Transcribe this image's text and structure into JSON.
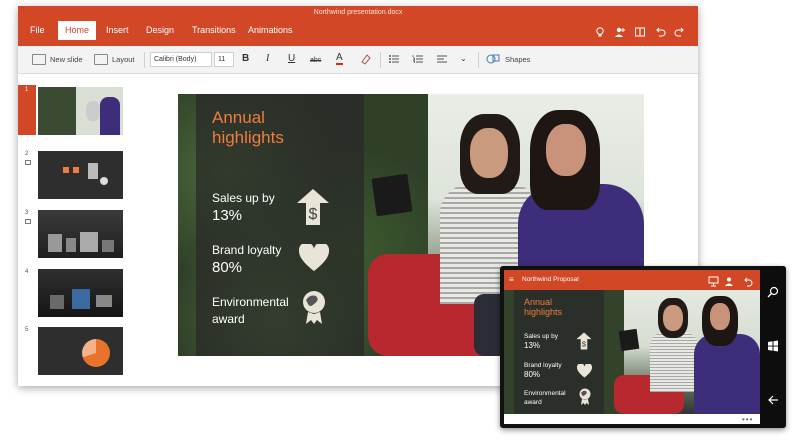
{
  "window": {
    "doc_title": "Northwind presentation.docx",
    "tabs": [
      "File",
      "Home",
      "Insert",
      "Design",
      "Transitions",
      "Animations"
    ],
    "active_tab": "Home",
    "title_icons": [
      "lightbulb-icon",
      "share-person-icon",
      "reading-view-icon",
      "undo-icon",
      "redo-icon"
    ]
  },
  "ribbon": {
    "new_slide": "New slide",
    "layout": "Layout",
    "font_name": "Calibri (Body)",
    "font_size": "11",
    "bold": "B",
    "italic": "I",
    "underline": "U",
    "strike": "abc",
    "font_color": "A",
    "shapes": "Shapes"
  },
  "thumbnails": [
    {
      "num": "1",
      "selected": true
    },
    {
      "num": "2",
      "selected": false
    },
    {
      "num": "3",
      "selected": false
    },
    {
      "num": "4",
      "selected": false
    },
    {
      "num": "5",
      "selected": false
    }
  ],
  "slide": {
    "title_line1": "Annual",
    "title_line2": "highlights",
    "items": [
      {
        "line1": "Sales up by",
        "line2": "13%",
        "icon": "dollar-arrow-icon"
      },
      {
        "line1": "Brand loyalty",
        "line2": "80%",
        "icon": "heart-icon"
      },
      {
        "line1": "Environmental",
        "line2": "award",
        "icon": "globe-award-icon"
      }
    ]
  },
  "phone": {
    "title": "Northwind Proposal",
    "dots": "•••"
  },
  "colors": {
    "accent": "#d24726",
    "slide_title": "#f07c3e"
  }
}
